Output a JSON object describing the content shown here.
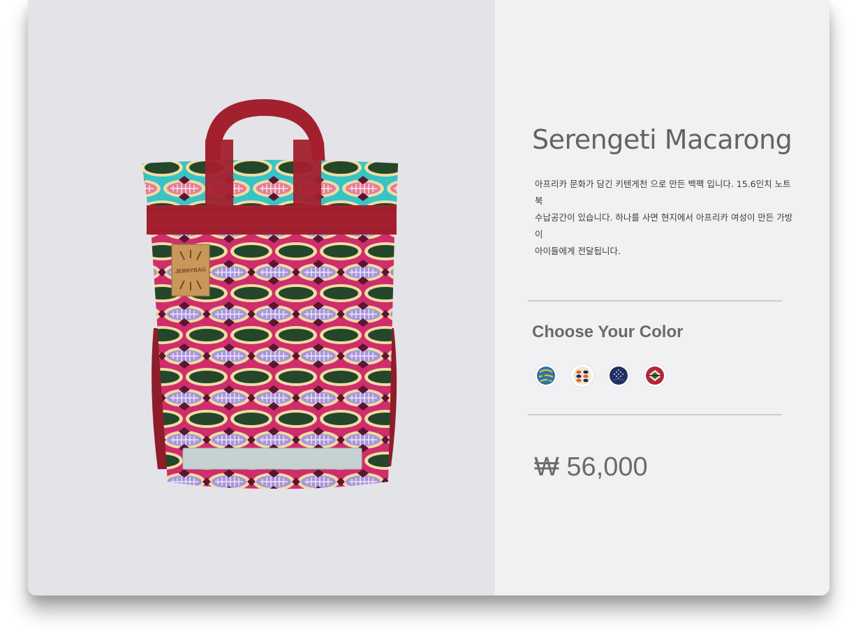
{
  "product": {
    "title": "Serengeti Macarong",
    "description_lines": [
      "아프리카 문화가 담긴 키텐게천 으로 만든 백팩 입니다. 15.6인치 노트북",
      "수납공간이 있습니다. 하나를 사면 현지에서 아프리카 여성이 만든 가방이",
      "아이들에게 전달됩니다."
    ],
    "image_alt": "Serengeti Macarong backpack",
    "patch_text": "JERRYBAG",
    "color_heading": "Choose Your Color",
    "color_options": [
      {
        "name": "blue-green-pattern-swatch",
        "colors": [
          "#2f6fb5",
          "#d9c23a",
          "#2a8a6a"
        ]
      },
      {
        "name": "orange-navy-pattern-swatch",
        "colors": [
          "#e2632a",
          "#1c2a55",
          "#f3e6d2"
        ]
      },
      {
        "name": "navy-dotted-pattern-swatch",
        "colors": [
          "#232f63",
          "#dcdde7",
          "#3a4a86"
        ]
      },
      {
        "name": "red-green-pattern-swatch",
        "colors": [
          "#b3273a",
          "#2c6a35",
          "#f2e8d6"
        ]
      }
    ],
    "price": "₩ 56,000"
  },
  "colors": {
    "image_background": "#e4e3e8",
    "panel_background": "#f1f1f3",
    "strap": "#a3202f",
    "fabric_magenta": "#cf2d6b",
    "fabric_green": "#24462a",
    "fabric_cream": "#f0dca4",
    "fabric_turquoise": "#36c4c4",
    "fabric_lavender": "#a896d6",
    "fabric_maroon": "#5a1530"
  }
}
